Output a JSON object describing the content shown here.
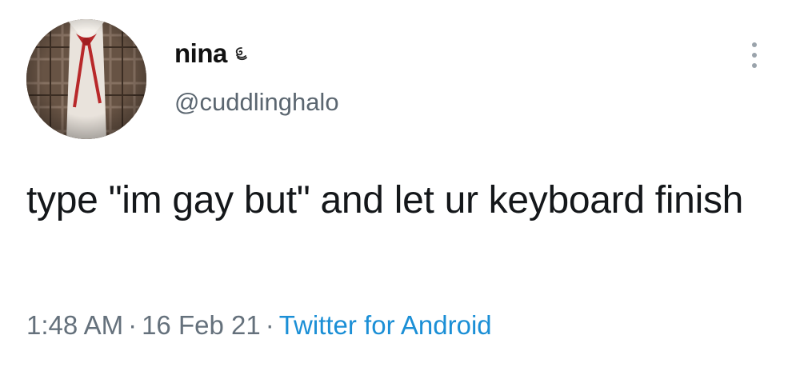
{
  "author": {
    "display_name": "nina",
    "name_emoji_icon": "whirl-icon",
    "handle": "@cuddlinghalo",
    "avatar_icon": "avatar-photo"
  },
  "tweet": {
    "text": "type \"im gay but\" and let ur keyboard finish"
  },
  "meta": {
    "time": "1:48 AM",
    "separator": "·",
    "date": "16 Feb 21",
    "source": "Twitter for Android"
  },
  "colors": {
    "text": "#14171a",
    "secondary": "#65717c",
    "link": "#1b8fd6",
    "background": "#ffffff"
  },
  "menu_icon": "more-vertical-icon"
}
